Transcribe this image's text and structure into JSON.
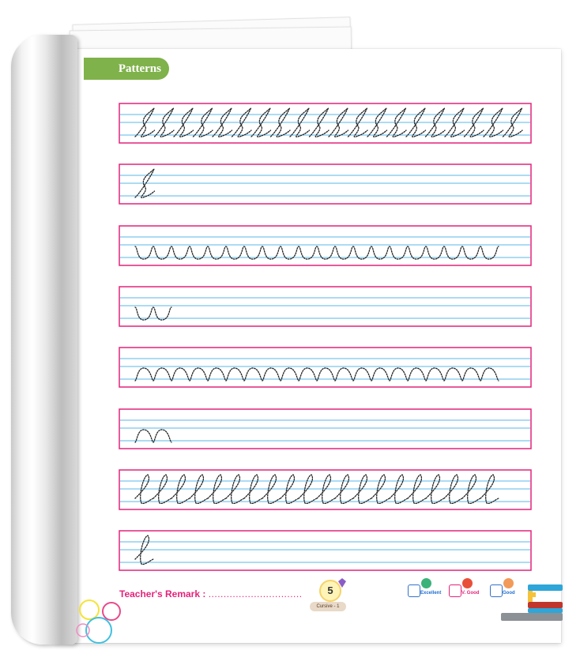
{
  "header": {
    "title": "Patterns"
  },
  "footer": {
    "remark_label": "Teacher's Remark :",
    "remark_line": "...............................",
    "page_number": "5",
    "book_label": "Cursive - 1",
    "ratings": [
      {
        "label": "Excellent",
        "color": "#1f6fd1",
        "face_color": "#3bb27a"
      },
      {
        "label": "V. Good",
        "color": "#e4237a",
        "face_color": "#e8503a"
      },
      {
        "label": "Good",
        "color": "#1f6fd1",
        "face_color": "#f29a5a"
      }
    ]
  },
  "colors": {
    "accent": "#7fb24a",
    "frame": "#e4237a",
    "guideline": "#5ab7e8",
    "trace": "#222222"
  },
  "rows": [
    {
      "pattern": "loop-s",
      "count": 20
    },
    {
      "pattern": "loop-s",
      "count": 1
    },
    {
      "pattern": "u-wave",
      "count": 20
    },
    {
      "pattern": "u-wave",
      "count": 2
    },
    {
      "pattern": "n-wave",
      "count": 20
    },
    {
      "pattern": "n-wave",
      "count": 2
    },
    {
      "pattern": "l-loop",
      "count": 20
    },
    {
      "pattern": "l-loop",
      "count": 1
    }
  ]
}
